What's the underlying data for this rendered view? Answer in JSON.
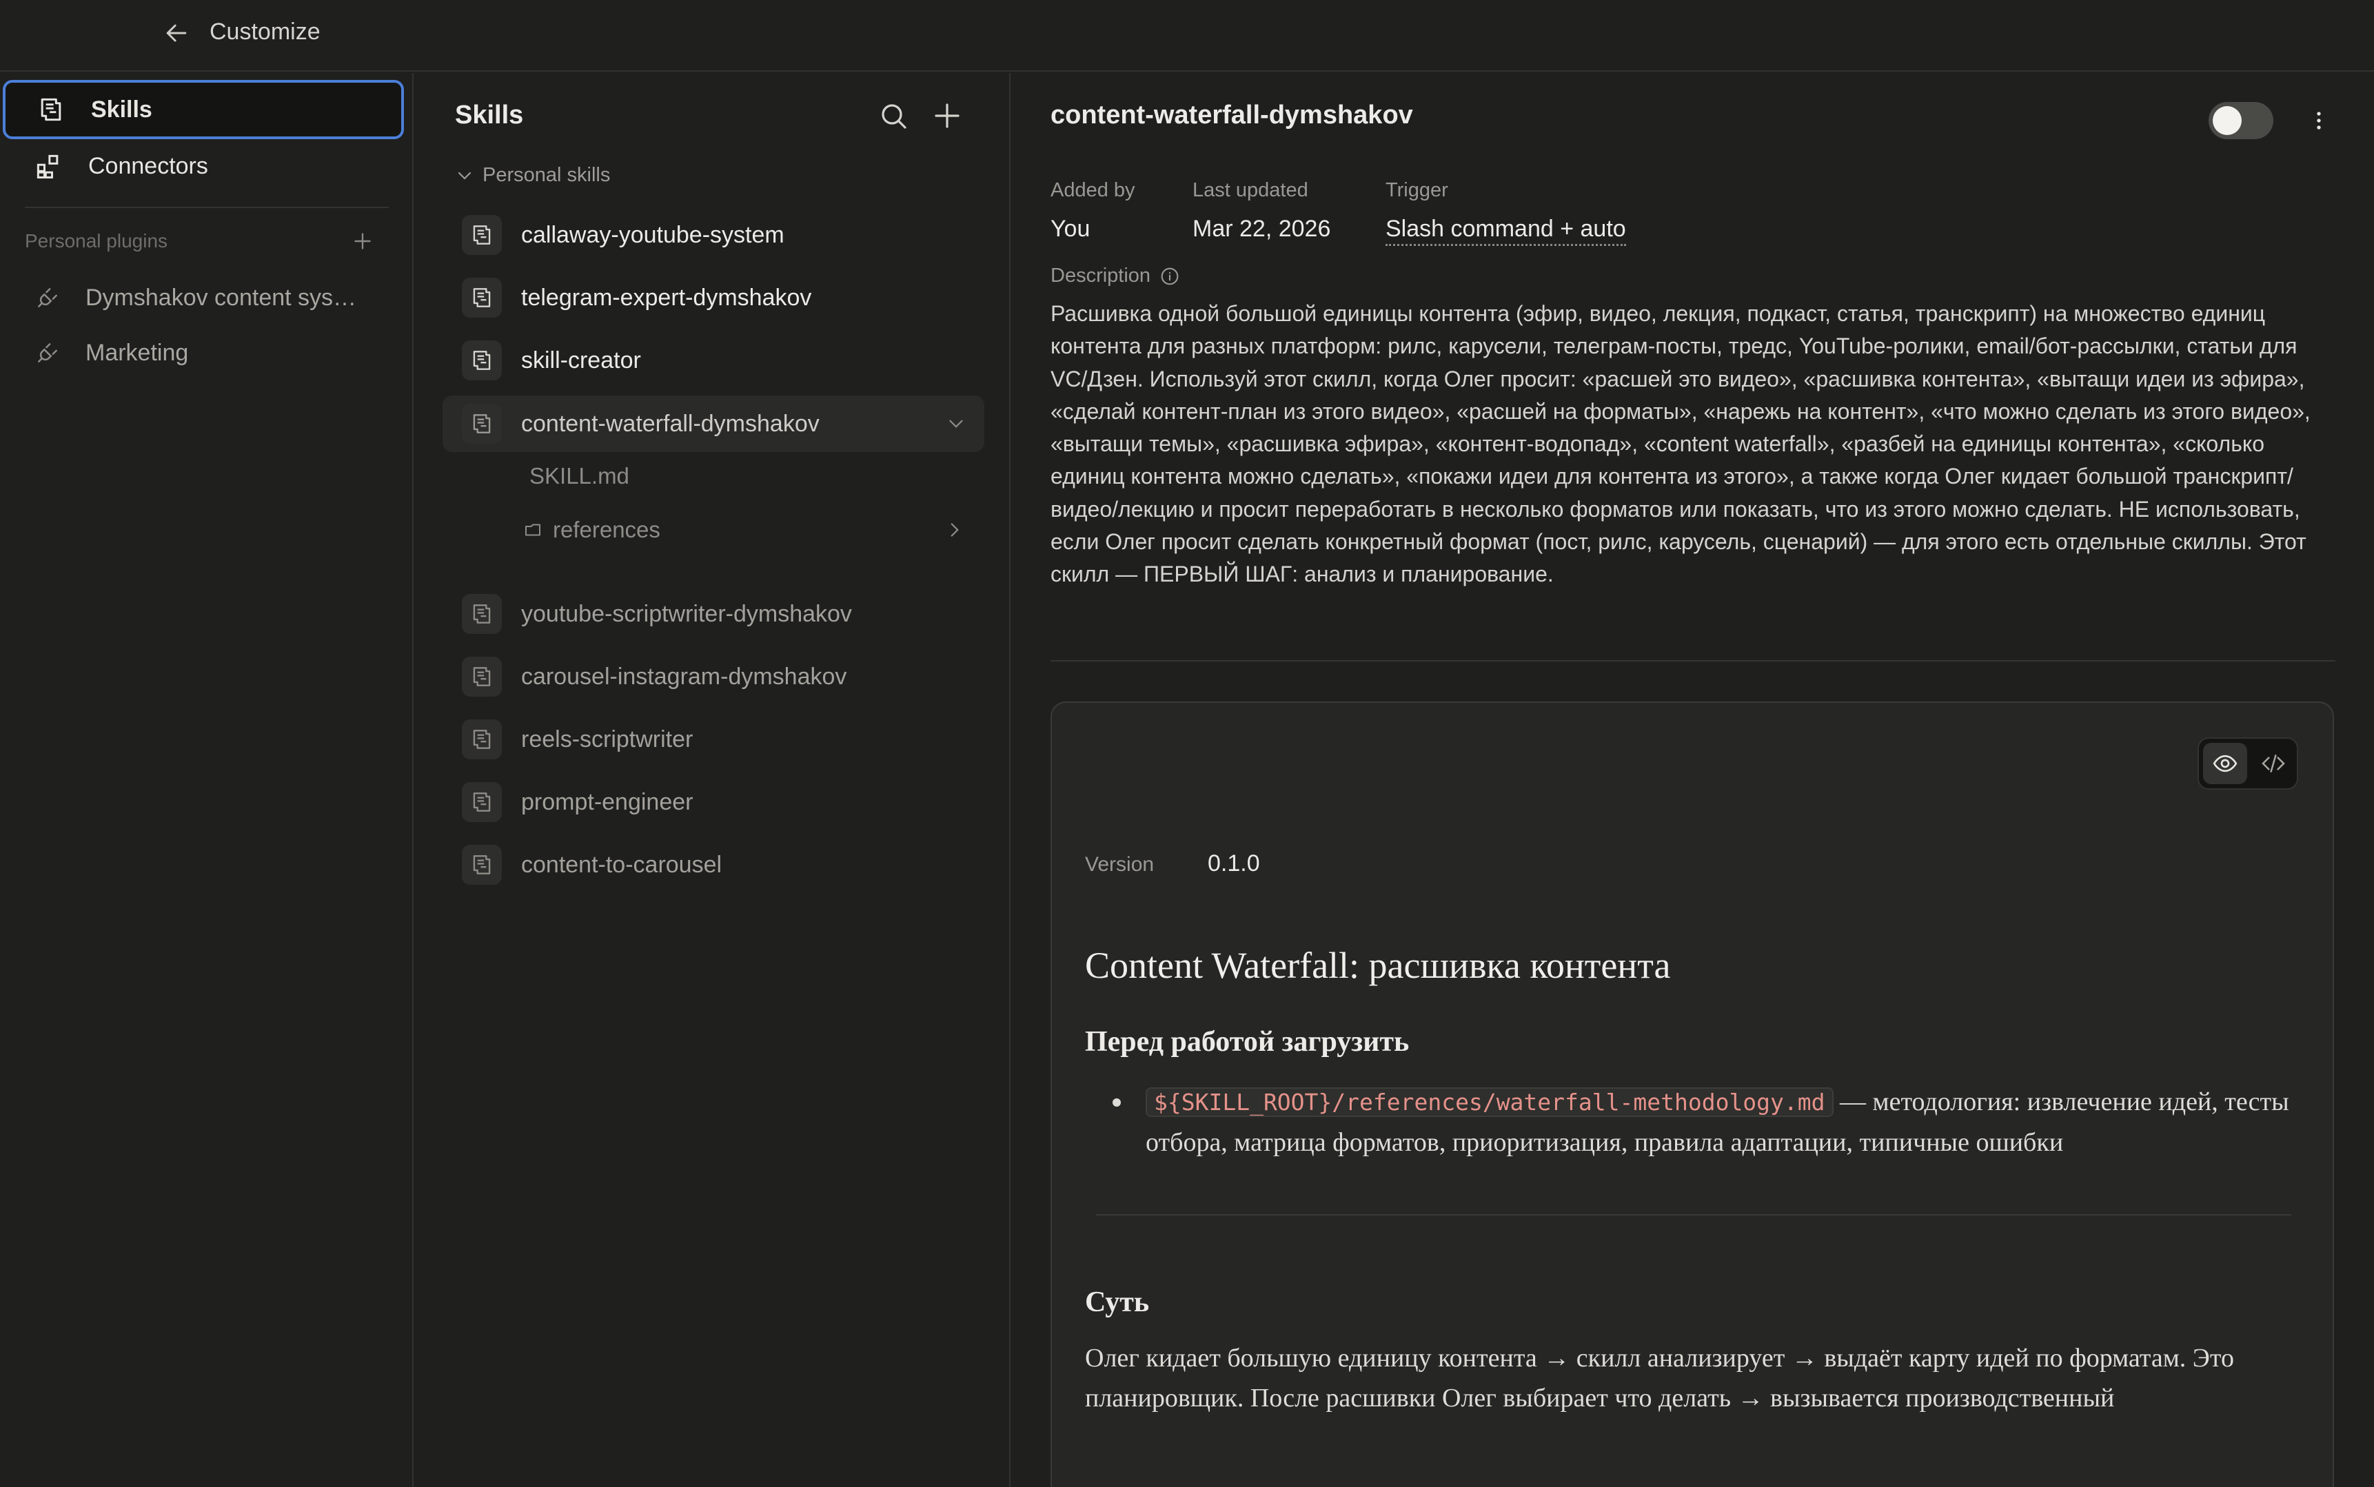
{
  "topbar": {
    "title": "Customize"
  },
  "sidebar": {
    "items": [
      {
        "label": "Skills",
        "icon": "skills-icon",
        "active": true
      },
      {
        "label": "Connectors",
        "icon": "connectors-icon",
        "active": false
      }
    ],
    "plugins_label": "Personal plugins",
    "plugins": [
      {
        "label": "Dymshakov content sys…",
        "icon": "plug-icon"
      },
      {
        "label": "Marketing",
        "icon": "plug-icon"
      }
    ]
  },
  "skills_panel": {
    "title": "Skills",
    "group_label": "Personal skills",
    "skills": [
      {
        "name": "callaway-youtube-system"
      },
      {
        "name": "telegram-expert-dymshakov"
      },
      {
        "name": "skill-creator"
      },
      {
        "name": "content-waterfall-dymshakov",
        "selected": true
      },
      {
        "name": "youtube-scriptwriter-dymshakov"
      },
      {
        "name": "carousel-instagram-dymshakov"
      },
      {
        "name": "reels-scriptwriter"
      },
      {
        "name": "prompt-engineer"
      },
      {
        "name": "content-to-carousel"
      }
    ],
    "files": [
      {
        "name": "SKILL.md"
      },
      {
        "name": "references"
      }
    ]
  },
  "detail": {
    "title": "content-waterfall-dymshakov",
    "added_by_label": "Added by",
    "added_by": "You",
    "last_updated_label": "Last updated",
    "last_updated": "Mar 22, 2026",
    "trigger_label": "Trigger",
    "trigger": "Slash command + auto",
    "description_label": "Description",
    "description": "Расшивка одной большой единицы контента (эфир, видео, лекция, подкаст, статья, транскрипт) на множество единиц контента для разных платформ: рилс, карусели, телеграм-посты, тредс, YouTube-ролики, email/бот-рассылки, статьи для VC/Дзен. Используй этот скилл, когда Олег просит: «расшей это видео», «расшивка контента», «вытащи идеи из эфира», «сделай контент-план из этого видео», «расшей на форматы», «нарежь на контент», «что можно сделать из этого видео», «вытащи темы», «расшивка эфира», «контент-водопад», «content waterfall», «разбей на единицы контента», «сколько единиц контента можно сделать», «покажи идеи для контента из этого», а также когда Олег кидает большой транскрипт/видео/лекцию и просит переработать в несколько форматов или показать, что из этого можно сделать. НЕ использовать, если Олег просит сделать конкретный формат (пост, рилс, карусель, сценарий) — для этого есть отдельные скиллы. Этот скилл — ПЕРВЫЙ ШАГ: анализ и планирование.",
    "toggle_on": false
  },
  "card": {
    "version_label": "Version",
    "version": "0.1.0",
    "h1": "Content Waterfall: расшивка контента",
    "h2_load": "Перед работой загрузить",
    "bullet_code": "${SKILL_ROOT}/references/waterfall-methodology.md",
    "bullet_text": " — методология: извлечение идей, тесты отбора, матрица форматов, приоритизация, правила адаптации, типичные ошибки",
    "h2_essence": "Суть",
    "essence_text": "Олег кидает большую единицу контента → скилл анализирует → выдаёт карту идей по форматам. Это планировщик. После расшивки Олег выбирает что делать → вызывается производственный"
  },
  "colors": {
    "background": "#1f1f1e",
    "accent_focus": "#4c7fd9",
    "code_text": "#e5928a"
  }
}
